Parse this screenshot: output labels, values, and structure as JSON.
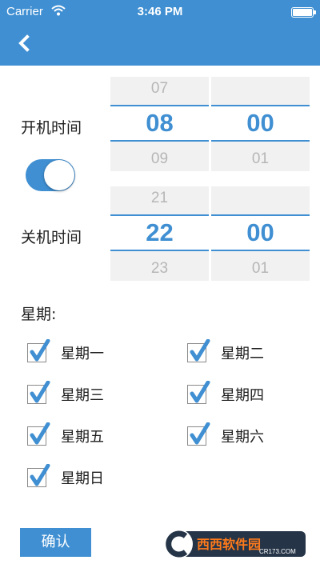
{
  "status_bar": {
    "carrier": "Carrier",
    "time": "3:46 PM"
  },
  "header": {
    "back_icon": "chevron-left-icon",
    "background_color": "#3f8fd2"
  },
  "power_on": {
    "label": "开机时间",
    "hour": {
      "above": "07",
      "selected": "08",
      "below": "09"
    },
    "minute": {
      "above": "",
      "selected": "00",
      "below": "01"
    }
  },
  "toggle": {
    "enabled": true
  },
  "power_off": {
    "label": "关机时间",
    "hour": {
      "above": "21",
      "selected": "22",
      "below": "23"
    },
    "minute": {
      "above": "",
      "selected": "00",
      "below": "01"
    }
  },
  "weekdays": {
    "title": "星期:",
    "days": [
      {
        "label": "星期一",
        "checked": true
      },
      {
        "label": "星期二",
        "checked": true
      },
      {
        "label": "星期三",
        "checked": true
      },
      {
        "label": "星期四",
        "checked": true
      },
      {
        "label": "星期五",
        "checked": true
      },
      {
        "label": "星期六",
        "checked": true
      },
      {
        "label": "星期日",
        "checked": true
      }
    ]
  },
  "confirm_button": {
    "label": "确认"
  },
  "watermark": {
    "text": "西西软件园",
    "subtext": "CR173.COM"
  },
  "colors": {
    "accent": "#3f8fd2",
    "picker_bg": "#f1f1f1",
    "faded_digit": "#b6b6b6",
    "check": "#3f8fd2"
  }
}
